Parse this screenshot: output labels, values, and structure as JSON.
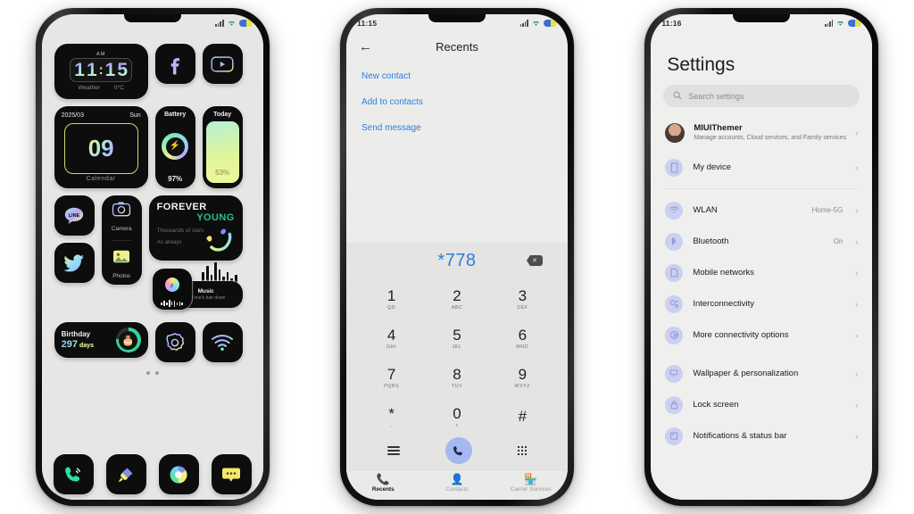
{
  "phone1": {
    "statusbar": {
      "time": "",
      "icons": [
        "signal-icon",
        "wifi-icon",
        "battery-icon"
      ]
    },
    "clock_widget": {
      "ampm": "AM",
      "h1": "1",
      "h2": "1",
      "sep": ":",
      "m1": "1",
      "m2": "5",
      "label": "Weather",
      "temp": "0°C"
    },
    "calendar_widget": {
      "date": "2025/03",
      "weekday": "Sun",
      "day": "09",
      "label": "Calendar"
    },
    "battery_widget": {
      "title": "Battery",
      "percent": "97%",
      "icon": "bolt-icon"
    },
    "today_widget": {
      "title": "Today",
      "percent": "53%"
    },
    "forever_widget": {
      "line1": "FOREVER",
      "line2": "YOUNG",
      "sub1": "Thousands of stars",
      "sub2": "As always"
    },
    "camera_photo_widget": {
      "camera_label": "Camera",
      "photos_label": "Photos"
    },
    "music_widget": {
      "title": "Music",
      "subtitle": "Let one's hair down"
    },
    "birthday_widget": {
      "title": "Birthday",
      "count": "297",
      "unit": "days",
      "icon": "cake-icon"
    },
    "icons": [
      {
        "name": "line-icon",
        "label": "LINE"
      },
      {
        "name": "twitter-icon",
        "label": ""
      },
      {
        "name": "facebook-icon",
        "label": "f"
      },
      {
        "name": "youtube-icon",
        "label": ""
      },
      {
        "name": "settings-gear-icon",
        "label": ""
      },
      {
        "name": "wifi-app-icon",
        "label": ""
      }
    ],
    "dock": [
      {
        "name": "phone-icon"
      },
      {
        "name": "themes-brush-icon"
      },
      {
        "name": "browser-icon"
      },
      {
        "name": "messages-icon"
      }
    ],
    "page_dots": 2
  },
  "phone2": {
    "statusbar": {
      "time": "11:15"
    },
    "header": {
      "back": "←",
      "title": "Recents"
    },
    "links": [
      "New contact",
      "Add to contacts",
      "Send message"
    ],
    "dialed_number": "*778",
    "backspace": "⌫",
    "keys": [
      {
        "digit": "1",
        "letters": "QD"
      },
      {
        "digit": "2",
        "letters": "ABC"
      },
      {
        "digit": "3",
        "letters": "DEF"
      },
      {
        "digit": "4",
        "letters": "GHI"
      },
      {
        "digit": "5",
        "letters": "JKL"
      },
      {
        "digit": "6",
        "letters": "MNO"
      },
      {
        "digit": "7",
        "letters": "PQRS"
      },
      {
        "digit": "8",
        "letters": "TUV"
      },
      {
        "digit": "9",
        "letters": "WXYZ"
      },
      {
        "digit": "*",
        "letters": ","
      },
      {
        "digit": "0",
        "letters": "+"
      },
      {
        "digit": "#",
        "letters": ""
      }
    ],
    "call_button": "call-icon",
    "tabs": [
      {
        "label": "Recents",
        "icon": "phone-handset-icon",
        "active": true
      },
      {
        "label": "Contacts",
        "icon": "person-icon",
        "active": false
      },
      {
        "label": "Carrier Services",
        "icon": "store-icon",
        "active": false
      }
    ],
    "accent_blue": "#2a7fdd",
    "call_button_color": "#a6b8f0"
  },
  "phone3": {
    "statusbar": {
      "time": "11:16"
    },
    "title": "Settings",
    "search": {
      "placeholder": "Search settings",
      "icon": "search-icon"
    },
    "account": {
      "name": "MIUIThemer",
      "desc": "Manage accounts, Cloud services, and Family services",
      "chevron": "›"
    },
    "groups": [
      {
        "items": [
          {
            "label": "My device",
            "value": "",
            "icon": "device-icon",
            "chevron": "›"
          }
        ]
      },
      {
        "items": [
          {
            "label": "WLAN",
            "value": "Home-5G",
            "icon": "wifi-icon",
            "chevron": "›"
          },
          {
            "label": "Bluetooth",
            "value": "On",
            "icon": "bluetooth-icon",
            "chevron": "›"
          },
          {
            "label": "Mobile networks",
            "value": "",
            "icon": "sim-icon",
            "chevron": "›"
          },
          {
            "label": "Interconnectivity",
            "value": "",
            "icon": "link-icon",
            "chevron": "›"
          },
          {
            "label": "More connectivity options",
            "value": "",
            "icon": "more-icon",
            "chevron": "›"
          }
        ]
      },
      {
        "items": [
          {
            "label": "Wallpaper & personalization",
            "value": "",
            "icon": "wallpaper-icon",
            "chevron": "›"
          },
          {
            "label": "Lock screen",
            "value": "",
            "icon": "lock-icon",
            "chevron": "›"
          },
          {
            "label": "Notifications & status bar",
            "value": "",
            "icon": "bell-icon",
            "chevron": "›"
          }
        ]
      }
    ]
  }
}
